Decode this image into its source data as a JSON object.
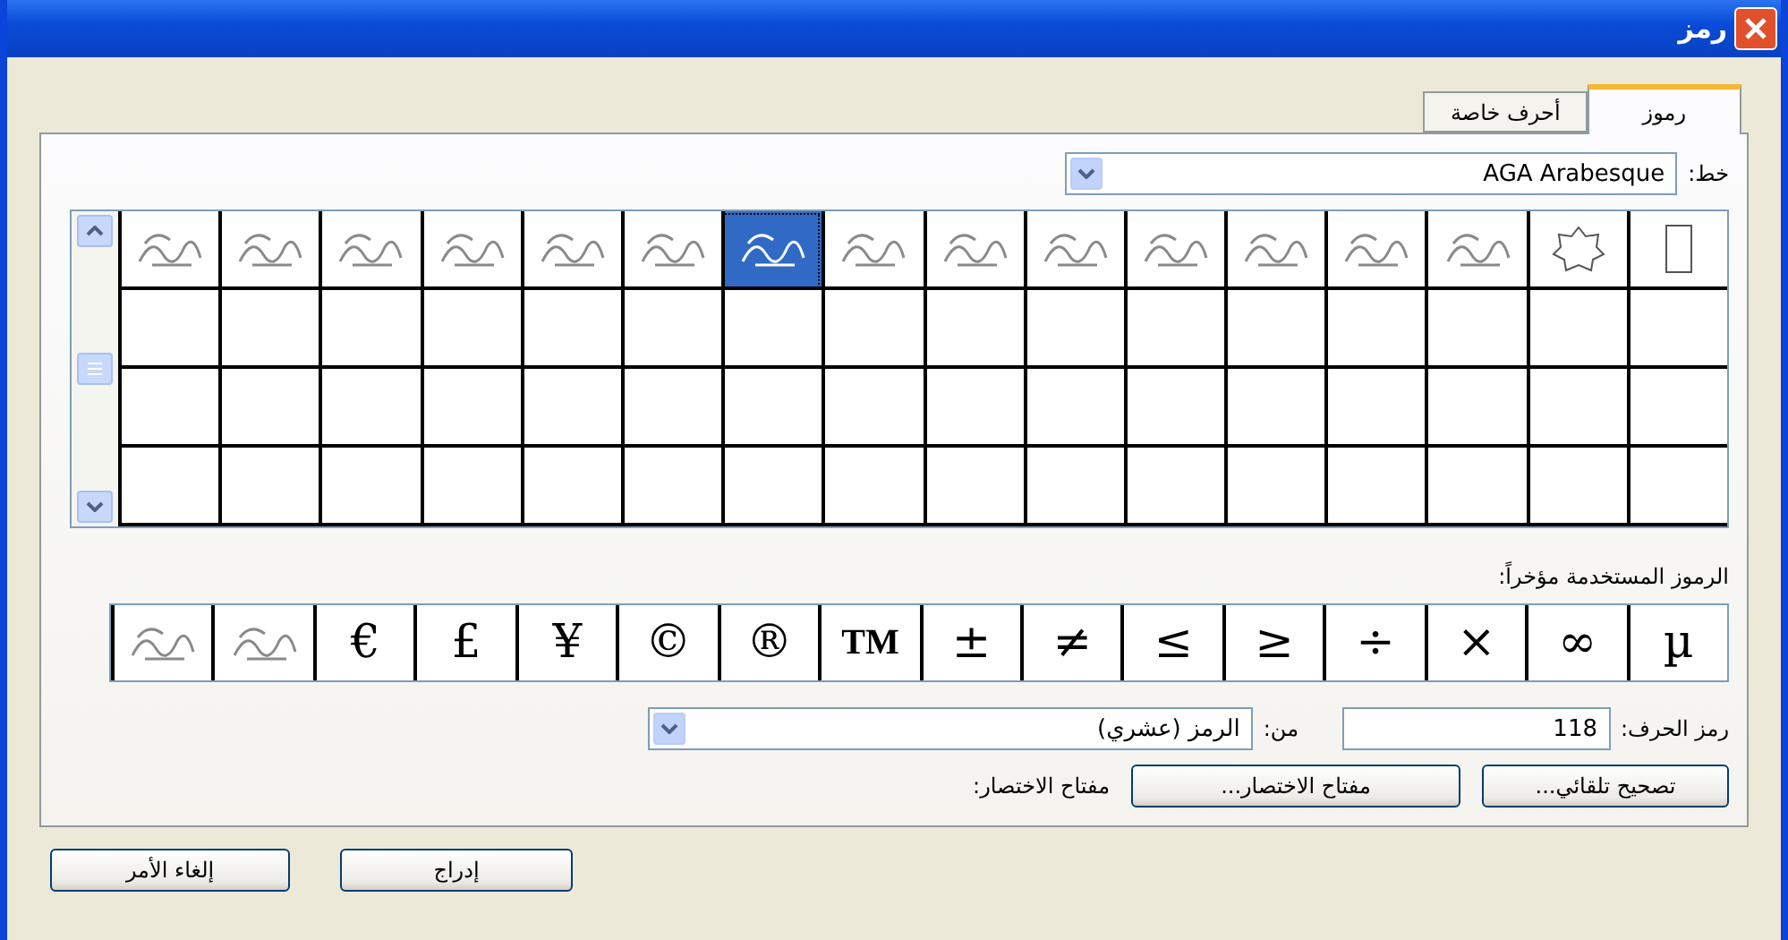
{
  "window": {
    "title": "رمز"
  },
  "tabs": [
    {
      "label": "رموز",
      "selected": true
    },
    {
      "label": "أحرف خاصة",
      "selected": false
    }
  ],
  "font": {
    "label": "خط:",
    "value": "AGA Arabesque"
  },
  "symbol_grid": {
    "cells": [
      {
        "selected": false
      },
      {
        "selected": false
      },
      {
        "selected": false
      },
      {
        "selected": false
      },
      {
        "selected": false
      },
      {
        "selected": false
      },
      {
        "selected": false
      },
      {
        "selected": false
      },
      {
        "selected": false
      },
      {
        "selected": true
      },
      {
        "selected": false
      },
      {
        "selected": false
      },
      {
        "selected": false
      },
      {
        "selected": false
      },
      {
        "selected": false
      },
      {
        "selected": false
      }
    ]
  },
  "recent": {
    "label": "الرموز المستخدمة مؤخراً:",
    "items": [
      {
        "kind": "text",
        "symbol": "µ"
      },
      {
        "kind": "text",
        "symbol": "∞"
      },
      {
        "kind": "text",
        "symbol": "×"
      },
      {
        "kind": "text",
        "symbol": "÷"
      },
      {
        "kind": "text",
        "symbol": "≥"
      },
      {
        "kind": "text",
        "symbol": "≤"
      },
      {
        "kind": "text",
        "symbol": "≠"
      },
      {
        "kind": "text",
        "symbol": "±"
      },
      {
        "kind": "text",
        "symbol": "TM"
      },
      {
        "kind": "text",
        "symbol": "®"
      },
      {
        "kind": "text",
        "symbol": "©"
      },
      {
        "kind": "text",
        "symbol": "¥"
      },
      {
        "kind": "text",
        "symbol": "£"
      },
      {
        "kind": "text",
        "symbol": "€"
      },
      {
        "kind": "image"
      },
      {
        "kind": "image"
      }
    ]
  },
  "char_code": {
    "label": "رمز الحرف:",
    "value": "118"
  },
  "from": {
    "label": "من:",
    "value": "الرمز (عشري)"
  },
  "shortcut_buttons": [
    "تصحيح تلقائي...",
    "مفتاح الاختصار..."
  ],
  "shortcut_label": "مفتاح الاختصار:",
  "buttons": [
    "إدراج",
    "إلغاء الأمر"
  ]
}
